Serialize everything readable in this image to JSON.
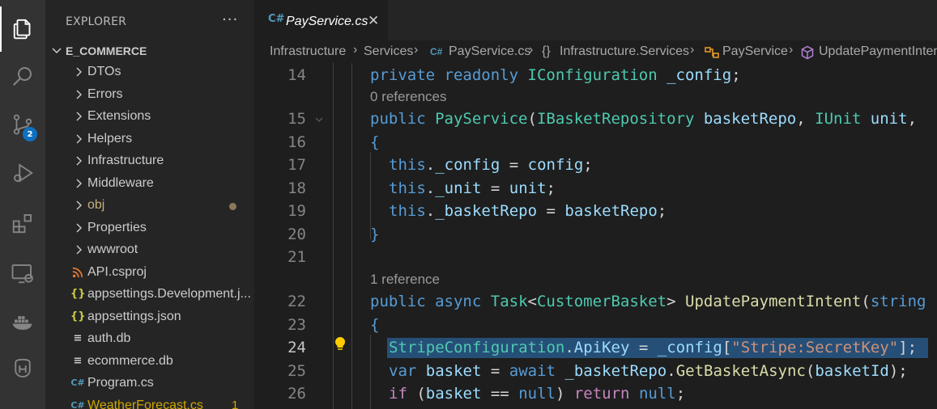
{
  "sidebar": {
    "title": "EXPLORER",
    "more": "···",
    "section": "E_COMMERCE",
    "items": [
      {
        "label": "DTOs",
        "kind": "folder",
        "color": "#cccccc"
      },
      {
        "label": "Errors",
        "kind": "folder",
        "color": "#cccccc"
      },
      {
        "label": "Extensions",
        "kind": "folder",
        "color": "#cccccc"
      },
      {
        "label": "Helpers",
        "kind": "folder",
        "color": "#cccccc"
      },
      {
        "label": "Infrastructure",
        "kind": "folder",
        "color": "#cccccc"
      },
      {
        "label": "Middleware",
        "kind": "folder",
        "color": "#cccccc"
      },
      {
        "label": "obj",
        "kind": "folder",
        "color": "#c5b07a"
      },
      {
        "label": "Properties",
        "kind": "folder",
        "color": "#cccccc"
      },
      {
        "label": "wwwroot",
        "kind": "folder",
        "color": "#cccccc"
      },
      {
        "label": "API.csproj",
        "kind": "rss",
        "color": "#cccccc"
      },
      {
        "label": "appsettings.Development.j...",
        "kind": "json",
        "color": "#cccccc"
      },
      {
        "label": "appsettings.json",
        "kind": "json",
        "color": "#cccccc"
      },
      {
        "label": "auth.db",
        "kind": "db",
        "color": "#cccccc"
      },
      {
        "label": "ecommerce.db",
        "kind": "db",
        "color": "#cccccc"
      },
      {
        "label": "Program.cs",
        "kind": "cs",
        "color": "#cccccc"
      },
      {
        "label": "WeatherForecast.cs",
        "kind": "cs",
        "color": "#cca700"
      }
    ],
    "obj_dot": "●",
    "weather_count": "1"
  },
  "activity": {
    "scm_badge": "2",
    "icons": [
      "explorer-icon",
      "search-icon",
      "source-control-icon",
      "run-debug-icon",
      "extensions-icon",
      "remote-explorer-icon",
      "docker-icon",
      "database-icon"
    ]
  },
  "editor": {
    "tab_label": "PayService.cs",
    "tab_icon": "C#",
    "tab_close": "✕",
    "breadcrumb": [
      "Infrastructure",
      "Services",
      "PayService.cs",
      "Infrastructure.Services",
      "PayService",
      "UpdatePaymentIntent"
    ],
    "lens_0": "0 references",
    "lens_1": "1 reference",
    "line_numbers": [
      "14",
      "15",
      "16",
      "17",
      "18",
      "19",
      "20",
      "21",
      "22",
      "23",
      "24",
      "25",
      "26"
    ]
  },
  "code": {
    "l14": [
      [
        "kw",
        "private"
      ],
      [
        "pl",
        " "
      ],
      [
        "kw",
        "readonly"
      ],
      [
        "pl",
        " "
      ],
      [
        "tp",
        "IConfiguration"
      ],
      [
        "pl",
        " "
      ],
      [
        "vr",
        "_config"
      ],
      [
        "pl",
        ";"
      ]
    ],
    "l15": [
      [
        "kw",
        "public"
      ],
      [
        "pl",
        " "
      ],
      [
        "tp",
        "PayService"
      ],
      [
        "pl",
        "("
      ],
      [
        "tp",
        "IBasketRepository"
      ],
      [
        "pl",
        " "
      ],
      [
        "vr",
        "basketRepo"
      ],
      [
        "pl",
        ", "
      ],
      [
        "tp",
        "IUnit"
      ],
      [
        "pl",
        " "
      ],
      [
        "vr",
        "unit"
      ],
      [
        "pl",
        ","
      ]
    ],
    "l16": [
      [
        "kw",
        "{"
      ]
    ],
    "l17": [
      [
        "kw",
        "this"
      ],
      [
        "pl",
        "."
      ],
      [
        "vr",
        "_config"
      ],
      [
        "pl",
        " = "
      ],
      [
        "vr",
        "config"
      ],
      [
        "pl",
        ";"
      ]
    ],
    "l18": [
      [
        "kw",
        "this"
      ],
      [
        "pl",
        "."
      ],
      [
        "vr",
        "_unit"
      ],
      [
        "pl",
        " = "
      ],
      [
        "vr",
        "unit"
      ],
      [
        "pl",
        ";"
      ]
    ],
    "l19": [
      [
        "kw",
        "this"
      ],
      [
        "pl",
        "."
      ],
      [
        "vr",
        "_basketRepo"
      ],
      [
        "pl",
        " = "
      ],
      [
        "vr",
        "basketRepo"
      ],
      [
        "pl",
        ";"
      ]
    ],
    "l20": [
      [
        "kw",
        "}"
      ]
    ],
    "l22": [
      [
        "kw",
        "public"
      ],
      [
        "pl",
        " "
      ],
      [
        "kw",
        "async"
      ],
      [
        "pl",
        " "
      ],
      [
        "tp",
        "Task"
      ],
      [
        "pl",
        "<"
      ],
      [
        "tp",
        "CustomerBasket"
      ],
      [
        "pl",
        "> "
      ],
      [
        "fn",
        "UpdatePaymentIntent"
      ],
      [
        "pl",
        "("
      ],
      [
        "kw",
        "string"
      ]
    ],
    "l23": [
      [
        "kw",
        "{"
      ]
    ],
    "l24": [
      [
        "tp",
        "StripeConfiguration"
      ],
      [
        "pl",
        "."
      ],
      [
        "vr",
        "ApiKey"
      ],
      [
        "pl",
        " = "
      ],
      [
        "vr",
        "_config"
      ],
      [
        "pl",
        "["
      ],
      [
        "st",
        "\"Stripe:SecretKey\""
      ],
      [
        "pl",
        "];"
      ]
    ],
    "l25": [
      [
        "kw",
        "var"
      ],
      [
        "pl",
        " "
      ],
      [
        "vr",
        "basket"
      ],
      [
        "pl",
        " = "
      ],
      [
        "kw",
        "await"
      ],
      [
        "pl",
        " "
      ],
      [
        "vr",
        "_basketRepo"
      ],
      [
        "pl",
        "."
      ],
      [
        "fn",
        "GetBasketAsync"
      ],
      [
        "pl",
        "("
      ],
      [
        "vr",
        "basketId"
      ],
      [
        "pl",
        ");"
      ]
    ],
    "l26": [
      [
        "ct",
        "if"
      ],
      [
        "pl",
        " ("
      ],
      [
        "vr",
        "basket"
      ],
      [
        "pl",
        " == "
      ],
      [
        "kw",
        "null"
      ],
      [
        "pl",
        ") "
      ],
      [
        "ct",
        "return"
      ],
      [
        "pl",
        " "
      ],
      [
        "kw",
        "null"
      ],
      [
        "pl",
        ";"
      ]
    ]
  }
}
